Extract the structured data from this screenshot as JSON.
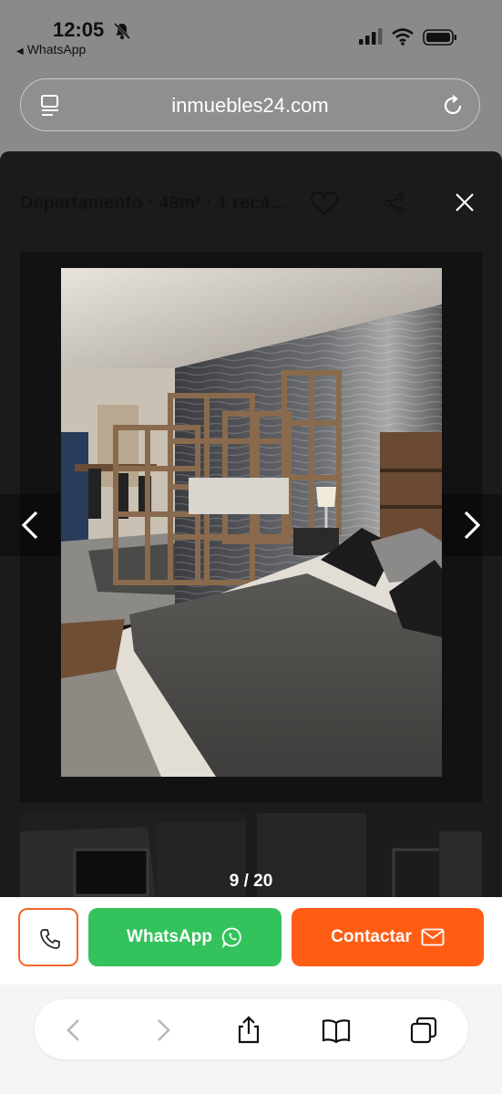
{
  "status_bar": {
    "time": "12:05",
    "back_app": "WhatsApp",
    "icons": [
      "bell-slash-icon",
      "signal-icon",
      "wifi-icon",
      "battery-icon"
    ]
  },
  "browser": {
    "url": "inmuebles24.com",
    "icons": [
      "page-menu-icon",
      "reload-icon"
    ]
  },
  "listing": {
    "title": "Departamento · 49m² · 1 recá...",
    "counter": "9 / 20",
    "icons": [
      "heart-icon",
      "share-icon",
      "close-icon",
      "chevron-left-icon",
      "chevron-right-icon"
    ]
  },
  "actions": {
    "whatsapp_label": "WhatsApp",
    "contact_label": "Contactar",
    "icons": [
      "phone-icon",
      "whatsapp-icon",
      "mail-icon"
    ]
  },
  "toolbar": {
    "icons": [
      "back-icon",
      "forward-icon",
      "share-icon",
      "bookmarks-icon",
      "tabs-icon"
    ]
  },
  "colors": {
    "whatsapp_green": "#34c25d",
    "contact_orange": "#ff5d14",
    "call_border": "#f0672b",
    "overlay_dark": "#1b1b1b"
  }
}
